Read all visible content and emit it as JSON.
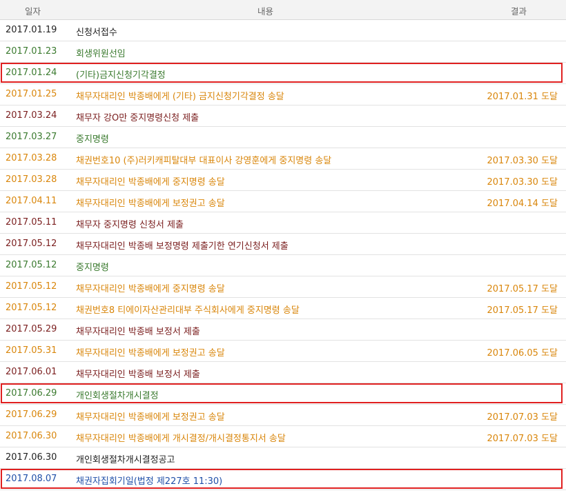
{
  "header": {
    "date": "일자",
    "content": "내용",
    "result": "결과"
  },
  "rows": [
    {
      "date": "2017.01.19",
      "content": "신청서접수",
      "result": "",
      "kind": "black",
      "highlight": false
    },
    {
      "date": "2017.01.23",
      "content": "회생위원선임",
      "result": "",
      "kind": "green",
      "highlight": false
    },
    {
      "date": "2017.01.24",
      "content": "(기타)금지신청기각결정",
      "result": "",
      "kind": "green",
      "highlight": true
    },
    {
      "date": "2017.01.25",
      "content": "채무자대리인 박종배에게 (기타) 금지신청기각결정 송달",
      "result": "2017.01.31 도달",
      "kind": "orange",
      "highlight": false
    },
    {
      "date": "2017.03.24",
      "content": "채무자 강O만 중지명령신청 제출",
      "result": "",
      "kind": "maroon",
      "highlight": false
    },
    {
      "date": "2017.03.27",
      "content": "중지명령",
      "result": "",
      "kind": "green",
      "highlight": false
    },
    {
      "date": "2017.03.28",
      "content": "채권번호10 (주)러키캐피탈대부 대표이사 강영훈에게 중지명령 송달",
      "result": "2017.03.30 도달",
      "kind": "orange",
      "highlight": false
    },
    {
      "date": "2017.03.28",
      "content": "채무자대리인 박종배에게 중지명령 송달",
      "result": "2017.03.30 도달",
      "kind": "orange",
      "highlight": false
    },
    {
      "date": "2017.04.11",
      "content": "채무자대리인 박종배에게 보정권고 송달",
      "result": "2017.04.14 도달",
      "kind": "orange",
      "highlight": false
    },
    {
      "date": "2017.05.11",
      "content": "채무자            중지명령 신청서 제출",
      "result": "",
      "kind": "maroon",
      "highlight": false
    },
    {
      "date": "2017.05.12",
      "content": "채무자대리인 박종배 보정명령 제출기한 연기신청서 제출",
      "result": "",
      "kind": "maroon",
      "highlight": false
    },
    {
      "date": "2017.05.12",
      "content": "중지명령",
      "result": "",
      "kind": "green",
      "highlight": false
    },
    {
      "date": "2017.05.12",
      "content": "채무자대리인 박종배에게 중지명령 송달",
      "result": "2017.05.17 도달",
      "kind": "orange",
      "highlight": false
    },
    {
      "date": "2017.05.12",
      "content": "채권번호8 티에이자산관리대부 주식회사에게 중지명령 송달",
      "result": "2017.05.17 도달",
      "kind": "orange",
      "highlight": false
    },
    {
      "date": "2017.05.29",
      "content": "채무자대리인 박종배 보정서 제출",
      "result": "",
      "kind": "maroon",
      "highlight": false
    },
    {
      "date": "2017.05.31",
      "content": "채무자대리인 박종배에게 보정권고 송달",
      "result": "2017.06.05 도달",
      "kind": "orange",
      "highlight": false
    },
    {
      "date": "2017.06.01",
      "content": "채무자대리인 박종배 보정서 제출",
      "result": "",
      "kind": "maroon",
      "highlight": false
    },
    {
      "date": "2017.06.29",
      "content": "개인회생절차개시결정",
      "result": "",
      "kind": "green",
      "highlight": true
    },
    {
      "date": "2017.06.29",
      "content": "채무자대리인 박종배에게 보정권고 송달",
      "result": "2017.07.03 도달",
      "kind": "orange",
      "highlight": false
    },
    {
      "date": "2017.06.30",
      "content": "채무자대리인 박종배에게 개시결정/개시결정통지서 송달",
      "result": "2017.07.03 도달",
      "kind": "orange",
      "highlight": false
    },
    {
      "date": "2017.06.30",
      "content": "개인회생절차개시결정공고",
      "result": "",
      "kind": "black",
      "highlight": false
    },
    {
      "date": "2017.08.07",
      "content": "채권자집회기일(법정 제227호 11:30)",
      "result": "",
      "kind": "blue",
      "highlight": true
    }
  ]
}
